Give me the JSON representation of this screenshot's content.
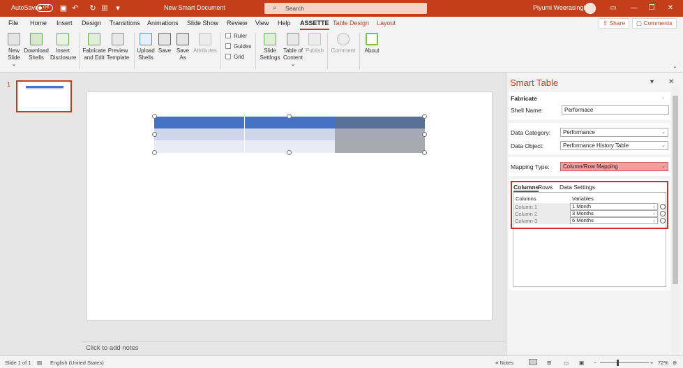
{
  "titlebar": {
    "autosave_label": "AutoSave",
    "autosave_state": "Off",
    "document_title": "New Smart Document",
    "search_placeholder": "Search",
    "user_name": "Piyumi Weerasinghe"
  },
  "menu": {
    "tabs": [
      "File",
      "Home",
      "Insert",
      "Design",
      "Transitions",
      "Animations",
      "Slide Show",
      "Review",
      "View",
      "Help",
      "ASSETTE",
      "Table Design",
      "Layout"
    ],
    "share_label": "Share",
    "comments_label": "Comments"
  },
  "ribbon": {
    "new_slide": "New Slide",
    "download_shells_1": "Download",
    "download_shells_2": "Shells",
    "insert_disclosure_1": "Insert",
    "insert_disclosure_2": "Disclosure",
    "fabricate_1": "Fabricate",
    "fabricate_2": "and Edit",
    "preview_1": "Preview",
    "preview_2": "Template",
    "upload_1": "Upload",
    "upload_2": "Shells",
    "save": "Save",
    "save_as_1": "Save",
    "save_as_2": "As",
    "attributes": "Attributes",
    "ruler": "Ruler",
    "guides": "Guides",
    "grid": "Grid",
    "slide_settings_1": "Slide",
    "slide_settings_2": "Settings",
    "toc_1": "Table of",
    "toc_2": "Content",
    "publish": "Publish",
    "comment": "Comment",
    "about": "About"
  },
  "slides_panel": {
    "slide_number": "1"
  },
  "notes_placeholder": "Click to add notes",
  "pane": {
    "title": "Smart Table",
    "section_title": "Fabricate",
    "shell_name_label": "Shell Name:",
    "shell_name_value": "Performace",
    "data_category_label": "Data Category:",
    "data_category_value": "Performance",
    "data_object_label": "Data Object:",
    "data_object_value": "Performance History Table",
    "mapping_type_label": "Mapping Type:",
    "mapping_type_value": "Column/Row Mapping",
    "tabs": [
      "Columns",
      "Rows",
      "Data Settings"
    ],
    "mapping_headers": [
      "Columns",
      "Variables"
    ],
    "mapping_rows": [
      {
        "column": "Column 1",
        "variable": "1 Month"
      },
      {
        "column": "Column 2",
        "variable": "3 Months"
      },
      {
        "column": "Column 3",
        "variable": "6 Months"
      }
    ]
  },
  "status": {
    "slide_info": "Slide 1 of 1",
    "language": "English (United States)",
    "notes": "Notes",
    "zoom": "72%"
  },
  "colors": {
    "accent": "#c43e1c",
    "table_header": "#4472c4",
    "table_header_selected": "#5a6f9a",
    "highlight_field": "#f19f9d",
    "highlight_frame": "#d9262c"
  }
}
